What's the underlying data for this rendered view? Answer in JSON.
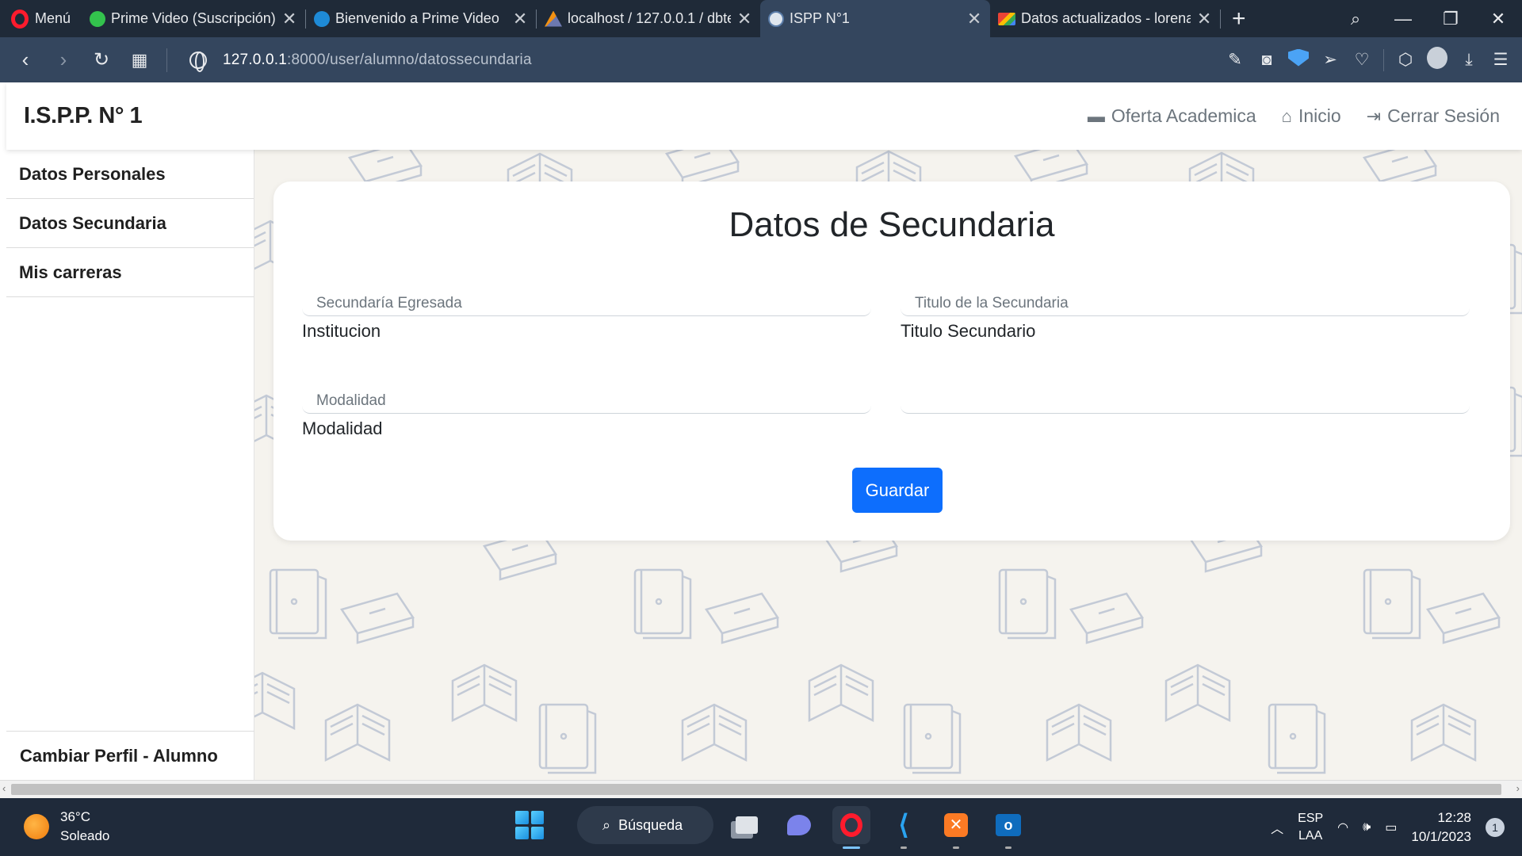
{
  "browser": {
    "menu_label": "Menú",
    "tabs": [
      {
        "title": "Prime Video (Suscripción) -",
        "icon": "prime-video-icon"
      },
      {
        "title": "Bienvenido a Prime Video",
        "icon": "prime-video-icon"
      },
      {
        "title": "localhost / 127.0.0.1 / dbter",
        "icon": "phpmyadmin-icon"
      },
      {
        "title": "ISPP N°1",
        "icon": "ispp-icon",
        "active": true
      },
      {
        "title": "Datos actualizados - lorena",
        "icon": "gmail-icon"
      }
    ],
    "url_host": "127.0.0.1",
    "url_path": ":8000/user/alumno/datossecundaria"
  },
  "navbar": {
    "brand": "I.S.P.P. N° 1",
    "links": {
      "oferta": "Oferta Academica",
      "inicio": "Inicio",
      "logout": "Cerrar Sesión"
    }
  },
  "sidebar": {
    "items": [
      {
        "label": "Datos Personales"
      },
      {
        "label": "Datos Secundaria"
      },
      {
        "label": "Mis carreras"
      }
    ],
    "bottom": "Cambiar Perfil - Alumno"
  },
  "form": {
    "title": "Datos de Secundaria",
    "fields": {
      "secundaria": {
        "placeholder": "Secundaría Egresada",
        "label": "Institucion"
      },
      "titulo": {
        "placeholder": "Titulo de la Secundaria",
        "label": "Titulo Secundario"
      },
      "modalidad": {
        "placeholder": "Modalidad",
        "label": "Modalidad"
      },
      "extra": {
        "placeholder": ""
      }
    },
    "submit": "Guardar"
  },
  "taskbar": {
    "temperature": "36°C",
    "weather": "Soleado",
    "search": "Búsqueda",
    "lang_top": "ESP",
    "lang_bottom": "LAA",
    "time": "12:28",
    "date": "10/1/2023",
    "notifications": "1"
  },
  "colors": {
    "primary_button": "#0d6efd",
    "tab_bar": "#1f2a38",
    "address_bar": "#34465e",
    "content_bg": "#f5f3ee"
  }
}
